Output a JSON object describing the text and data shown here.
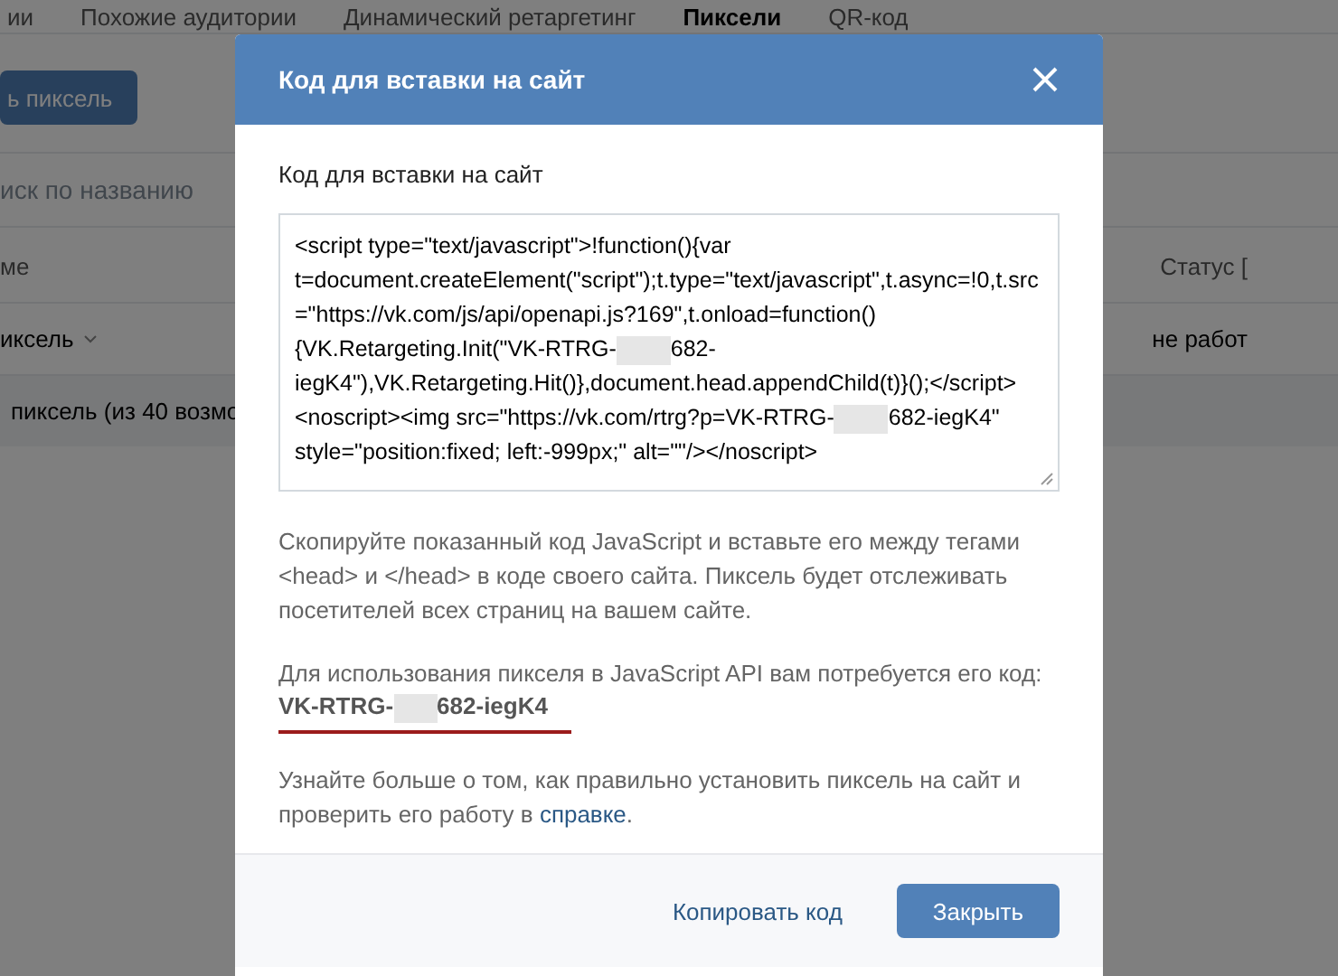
{
  "background_page": {
    "tabs": [
      {
        "label": "ии",
        "selected": false
      },
      {
        "label": "Похожие аудитории",
        "selected": false
      },
      {
        "label": "Динамический ретаргетинг",
        "selected": false
      },
      {
        "label": "Пиксели",
        "selected": true
      },
      {
        "label": "QR-код",
        "selected": false
      }
    ],
    "create_button": "ь пиксель",
    "search": {
      "placeholder": "иск по названию"
    },
    "table": {
      "columns": [
        "ме",
        "Статус ["
      ],
      "rows": [
        {
          "name": "иксель",
          "status": "не работ"
        }
      ],
      "footer": "пиксель (из 40 возмо"
    }
  },
  "modal": {
    "title": "Код для вставки на сайт",
    "code_label": "Код для вставки на сайт",
    "code_parts": [
      {
        "kind": "text",
        "text": "<script type=\"text/javascript\">!function(){var t=document.createElement(\"script\");t.type=\"text/javascript\",t.async=!0,t.src=\"https://vk.com/js/api/openapi.js?169\",t.onload=function(){VK.Retargeting.Init(\"VK-RTRG-"
      },
      {
        "kind": "redacted"
      },
      {
        "kind": "text",
        "text": "682-iegK4\"),VK.Retargeting.Hit()},document.head.appendChild(t)}();</script><noscript><img src=\"https://vk.com/rtrg?p=VK-RTRG-"
      },
      {
        "kind": "redacted"
      },
      {
        "kind": "text",
        "text": "682-iegK4\" style=\"position:fixed; left:-999px;\" alt=\"\"/></noscript>"
      }
    ],
    "instructions": "Скопируйте показанный код JavaScript и вставьте его между тегами <head> и </head> в коде своего сайта. Пиксель будет отслеживать посетителей всех страниц на вашем сайте.",
    "api_note": "Для использования пикселя в JavaScript API вам потребуется его код:",
    "pixel_code_parts": [
      {
        "kind": "text",
        "text": "VK-RTRG-"
      },
      {
        "kind": "redacted"
      },
      {
        "kind": "text",
        "text": "682-iegK4"
      }
    ],
    "help_text": {
      "before": "Узнайте больше о том, как правильно установить пиксель на сайт и проверить его работу в ",
      "link": "справке",
      "after": "."
    },
    "buttons": [
      {
        "label": "Копировать код",
        "kind": "secondary"
      },
      {
        "label": "Закрыть",
        "kind": "primary"
      }
    ]
  }
}
